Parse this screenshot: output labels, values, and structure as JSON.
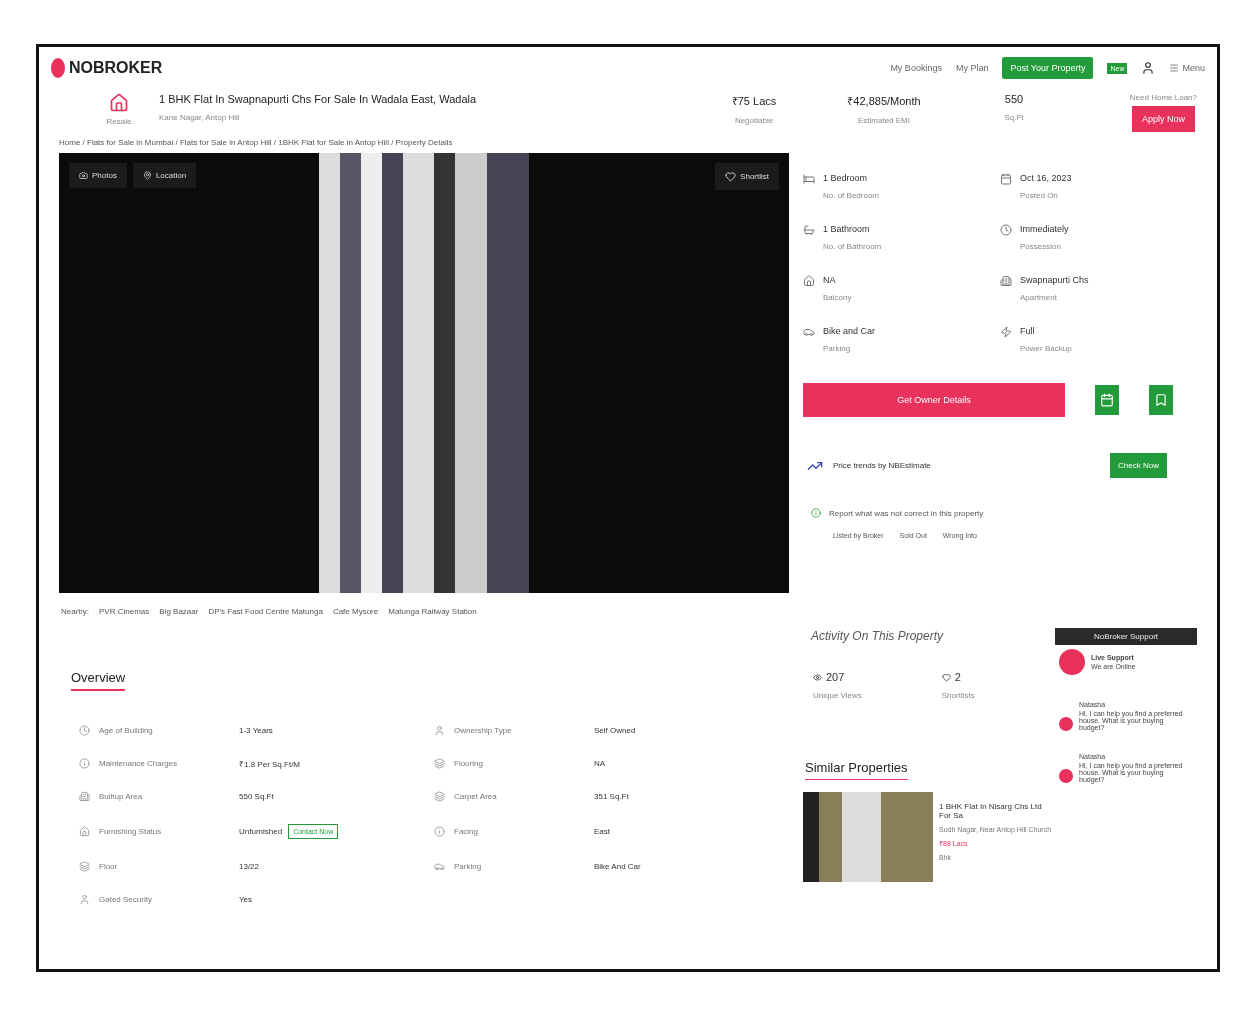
{
  "header": {
    "logo": "NOBROKER",
    "nav": [
      {
        "kind": "link",
        "label": "My Bookings"
      },
      {
        "kind": "link",
        "label": "My Plan"
      },
      {
        "kind": "cta",
        "label": "Post Your Property"
      },
      {
        "kind": "badge",
        "label": "New"
      },
      {
        "kind": "menu",
        "label": "Menu"
      }
    ]
  },
  "listing": {
    "type_label": "Resale",
    "title": "1 BHK Flat In Swapnapurti Chs For Sale In Wadala East, Wadala",
    "subtitle": "Kane Nagar, Antop Hill",
    "stats": [
      {
        "value": "₹75 Lacs",
        "label": "Negotiable"
      },
      {
        "value": "₹42,885/Month",
        "label": "Estimated EMI"
      },
      {
        "value": "550",
        "label": "Sq.Ft"
      }
    ],
    "loan": {
      "question": "Need Home Loan?",
      "button": "Apply Now"
    }
  },
  "breadcrumb": "Home / Flats for Sale in Mumbai / Flats for Sale in Antop Hill / 1BHK Flat for Sale in Antop Hill / Property Details",
  "gallery": {
    "buttons": [
      "Photos",
      "Location"
    ],
    "shortlist": "Shortlist"
  },
  "nearby": {
    "label": "Nearby:",
    "places": [
      "PVR Cinemas",
      "Big Bazaar",
      "DP's Fast Food Centre Matunga",
      "Cafe Mysore",
      "Matunga Railway Station"
    ]
  },
  "overview": {
    "title": "Overview",
    "items": [
      {
        "label": "Age of Building",
        "value": "1-3 Years"
      },
      {
        "label": "Ownership Type",
        "value": "Self Owned"
      },
      {
        "label": "Maintenance Charges",
        "value": "₹1.8 Per Sq.Ft/M"
      },
      {
        "label": "Flooring",
        "value": "NA"
      },
      {
        "label": "Builtup Area",
        "value": "550 Sq.Ft"
      },
      {
        "label": "Carpet Area",
        "value": "351 Sq.Ft"
      },
      {
        "label": "Furnishing Status",
        "value": "Unfurnished",
        "action": "Contact Now"
      },
      {
        "label": "Facing",
        "value": "East"
      },
      {
        "label": "Floor",
        "value": "13/22"
      },
      {
        "label": "Parking",
        "value": "Bike And Car"
      },
      {
        "label": "Gated Security",
        "value": "Yes"
      }
    ]
  },
  "details": [
    {
      "value": "1 Bedroom",
      "label": "No. of Bedroom"
    },
    {
      "value": "Oct 16, 2023",
      "label": "Posted On"
    },
    {
      "value": "1 Bathroom",
      "label": "No. of Bathroom"
    },
    {
      "value": "Immediately",
      "label": "Possession"
    },
    {
      "value": "NA",
      "label": "Balcony"
    },
    {
      "value": "Swapnapurti Chs",
      "label": "Apartment"
    },
    {
      "value": "Bike and Car",
      "label": "Parking"
    },
    {
      "value": "Full",
      "label": "Power Backup"
    }
  ],
  "owner_button": "Get Owner Details",
  "price_trends": {
    "label": "Price trends by NBEstimate",
    "button": "Check Now"
  },
  "report": {
    "label": "Report what was not correct in this property",
    "options": [
      "Listed by Broker",
      "Sold Out",
      "Wrong Info"
    ]
  },
  "activity": {
    "title": "Activity On This Property",
    "stats": [
      {
        "value": "207",
        "label": "Unique Views"
      },
      {
        "value": "2",
        "label": "Shortlists"
      }
    ]
  },
  "similar": {
    "title": "Similar Properties",
    "card": {
      "title": "1 BHK Flat In Nisarg Chs Ltd For Sa",
      "subtitle": "Sudh Nagar, Near Antop Hill Church",
      "price": "₹88 Lacs",
      "footer": "Bhk"
    }
  },
  "chat": {
    "header": "NoBroker Support",
    "agent": "Live Support",
    "status": "We are Online",
    "messages": [
      {
        "sender": "Natasha",
        "text": "Hi, I can help you find a preferred house. What is your buying budget?"
      },
      {
        "sender": "Natasha",
        "text": "Hi, I can help you find a preferred house. What is your buying budget?"
      }
    ]
  }
}
